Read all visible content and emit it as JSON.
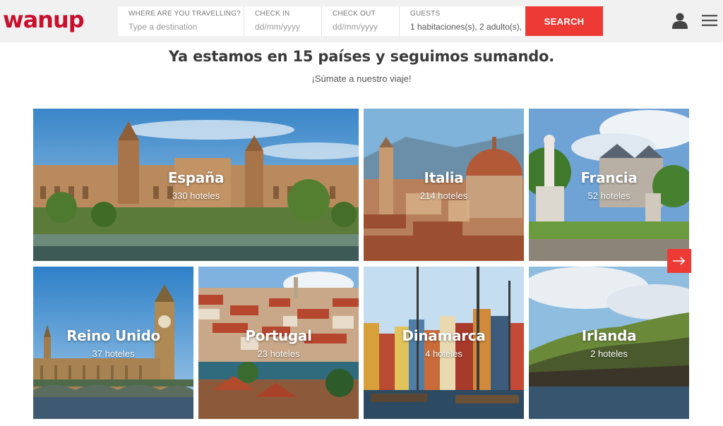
{
  "header": {
    "logo": "wanup",
    "search": {
      "destination": {
        "label": "WHERE ARE YOU TRAVELLING?",
        "placeholder": "Type a destination"
      },
      "checkin": {
        "label": "CHECK IN",
        "placeholder": "dd/mm/yyyy"
      },
      "checkout": {
        "label": "CHECK OUT",
        "placeholder": "dd/mm/yyyy"
      },
      "guests": {
        "label": "GUESTS",
        "value": "1 habitaciones(s), 2 adulto(s),"
      },
      "button": "SEARCH"
    },
    "icons": [
      "user-icon",
      "hamburger-menu-icon"
    ]
  },
  "main": {
    "headline": "Ya estamos en 15 países y seguimos sumando.",
    "subline": "¡Súmate a nuestro viaje!",
    "destinations": [
      {
        "name": "España",
        "hotels": "330 hoteles"
      },
      {
        "name": "Italia",
        "hotels": "214 hoteles"
      },
      {
        "name": "Francia",
        "hotels": "52 hoteles"
      },
      {
        "name": "Reino Unido",
        "hotels": "37 hoteles"
      },
      {
        "name": "Portugal",
        "hotels": "23 hoteles"
      },
      {
        "name": "Dinamarca",
        "hotels": "4 hoteles"
      },
      {
        "name": "Irlanda",
        "hotels": "2 hoteles"
      }
    ],
    "next_icon": "arrow-right-icon"
  },
  "colors": {
    "brand": "#c8102e",
    "accent": "#ee3a35",
    "header_bg": "#f1f1f1"
  }
}
